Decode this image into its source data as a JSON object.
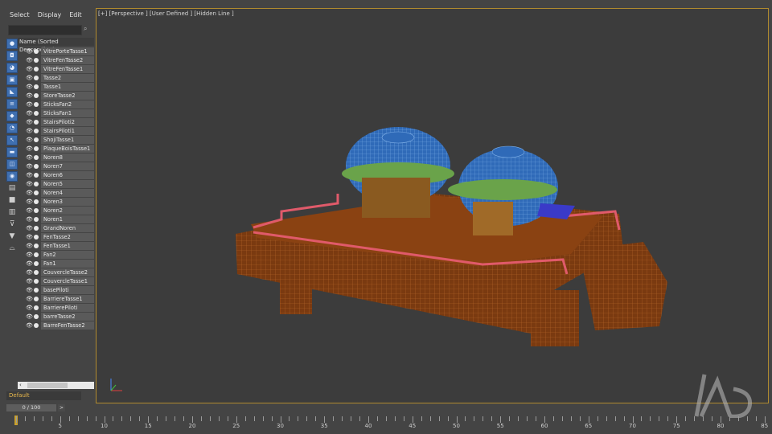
{
  "menu": [
    "Select",
    "Display",
    "Edit"
  ],
  "explorer": {
    "header": "Name (Sorted Descending)",
    "items": [
      "VitrePorteTasse1",
      "VitreFenTasse2",
      "VitreFenTasse1",
      "Tasse2",
      "Tasse1",
      "StoreTasse2",
      "SticksFan2",
      "SticksFan1",
      "StairsPiloti2",
      "StairsPiloti1",
      "ShojiTasse1",
      "PlaqueBoisTasse1",
      "Noren8",
      "Noren7",
      "Noren6",
      "Noren5",
      "Noren4",
      "Noren3",
      "Noren2",
      "Noren1",
      "GrandNoren",
      "FenTasse2",
      "FenTasse1",
      "Fan2",
      "Fan1",
      "CouvercleTasse2",
      "CouvercleTasse1",
      "basePiloti",
      "BarriereTasse1",
      "BarrierePiloti",
      "barreTasse2",
      "BarreFenTasse2"
    ]
  },
  "layer": "Default",
  "viewport": {
    "label": "[+] [Perspective ] [User Defined ] [Hidden Line ]"
  },
  "timeline": {
    "frame_indicator": "0 / 100",
    "next_label": ">",
    "numbers": [
      "5",
      "10",
      "15",
      "20",
      "25",
      "30",
      "35",
      "40",
      "45",
      "50",
      "55",
      "60",
      "65",
      "70",
      "75",
      "80",
      "85"
    ]
  },
  "colors": {
    "accent": "#3f6fb0",
    "viewport_border": "#b08a2e",
    "layer_text": "#e8b84d"
  }
}
